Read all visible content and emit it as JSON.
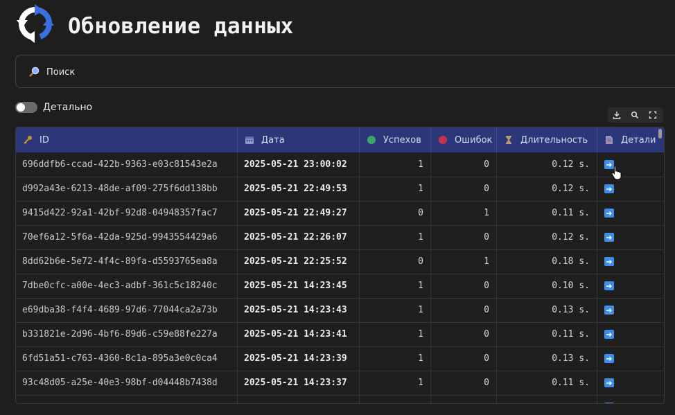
{
  "header": {
    "title": "Обновление данных",
    "logo_icon": "refresh-icon"
  },
  "search": {
    "placeholder": "Поиск",
    "value": "",
    "icon": "magnifier-icon"
  },
  "toggle": {
    "label": "Детально",
    "checked": false
  },
  "toolbar": {
    "icons": [
      "download-icon",
      "search-icon",
      "fullscreen-icon"
    ]
  },
  "table": {
    "columns": [
      {
        "label": "ID",
        "icon": "key-icon"
      },
      {
        "label": "Дата",
        "icon": "calendar-icon"
      },
      {
        "label": "Успехов",
        "icon": "green-circle-icon"
      },
      {
        "label": "Ошибок",
        "icon": "red-circle-icon"
      },
      {
        "label": "Длительность",
        "icon": "hourglass-icon"
      },
      {
        "label": "Детали",
        "icon": "document-icon"
      }
    ],
    "rows": [
      {
        "id": "696ddfb6-ccad-422b-9363-e03c81543e2a",
        "date": "2025-05-21 23:00:02",
        "success": "1",
        "errors": "0",
        "duration": "0.12 s."
      },
      {
        "id": "d992a43e-6213-48de-af09-275f6dd138bb",
        "date": "2025-05-21 22:49:53",
        "success": "1",
        "errors": "0",
        "duration": "0.12 s."
      },
      {
        "id": "9415d422-92a1-42bf-92d8-04948357fac7",
        "date": "2025-05-21 22:49:27",
        "success": "0",
        "errors": "1",
        "duration": "0.11 s."
      },
      {
        "id": "70ef6a12-5f6a-42da-925d-9943554429a6",
        "date": "2025-05-21 22:26:07",
        "success": "1",
        "errors": "0",
        "duration": "0.12 s."
      },
      {
        "id": "8dd62b6e-5e72-4f4c-89fa-d5593765ea8a",
        "date": "2025-05-21 22:25:52",
        "success": "0",
        "errors": "1",
        "duration": "0.18 s."
      },
      {
        "id": "7dbe0cfc-a00e-4ec3-adbf-361c5c18240c",
        "date": "2025-05-21 14:23:45",
        "success": "1",
        "errors": "0",
        "duration": "0.10 s."
      },
      {
        "id": "e69dba38-f4f4-4689-97d6-77044ca2a73b",
        "date": "2025-05-21 14:23:43",
        "success": "1",
        "errors": "0",
        "duration": "0.13 s."
      },
      {
        "id": "b331821e-2d96-4bf6-89d6-c59e88fe227a",
        "date": "2025-05-21 14:23:41",
        "success": "1",
        "errors": "0",
        "duration": "0.11 s."
      },
      {
        "id": "6fd51a51-c763-4360-8c1a-895a3e0c0ca4",
        "date": "2025-05-21 14:23:39",
        "success": "1",
        "errors": "0",
        "duration": "0.13 s."
      },
      {
        "id": "93c48d05-a25e-40e3-98bf-d04448b7438d",
        "date": "2025-05-21 14:23:37",
        "success": "1",
        "errors": "0",
        "duration": "0.11 s."
      }
    ]
  },
  "colors": {
    "background": "#1e1e1e",
    "header_bg": "#2b3779",
    "accent": "#3f8ee8"
  }
}
